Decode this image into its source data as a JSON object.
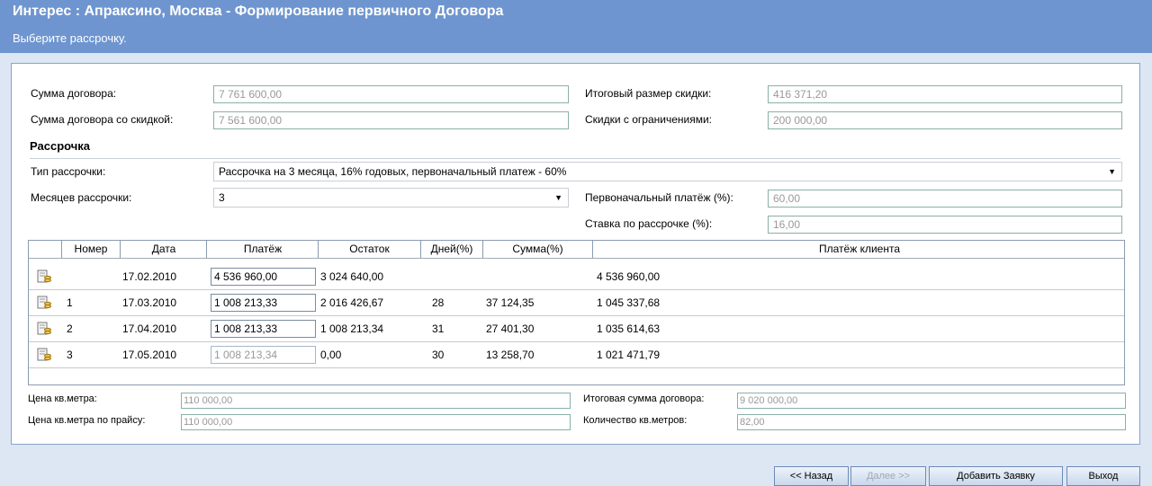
{
  "header": {
    "title": "Интерес : Апраксино, Москва - Формирование первичного Договора",
    "subtitle": "Выберите рассрочку."
  },
  "form": {
    "contract_sum_label": "Сумма договора:",
    "contract_sum_value": "7 761 600,00",
    "contract_sum_discount_label": "Сумма договора со скидкой:",
    "contract_sum_discount_value": "7 561 600,00",
    "total_discount_label": "Итоговый размер скидки:",
    "total_discount_value": "416 371,20",
    "limited_discounts_label": "Скидки с ограничениями:",
    "limited_discounts_value": "200 000,00"
  },
  "installment": {
    "section_title": "Рассрочка",
    "type_label": "Тип рассрочки:",
    "type_value": "Рассрочка на 3 месяца, 16% годовых, первоначальный платеж - 60%",
    "months_label": "Месяцев рассрочки:",
    "months_value": "3",
    "initial_payment_label": "Первоначальный платёж (%):",
    "initial_payment_value": "60,00",
    "rate_label": "Ставка по рассрочке (%):",
    "rate_value": "16,00"
  },
  "grid": {
    "columns": [
      "Номер",
      "Дата",
      "Платёж",
      "Остаток",
      "Дней(%)",
      "Сумма(%)",
      "Платёж клиента"
    ],
    "rows": [
      {
        "number": "",
        "date": "17.02.2010",
        "payment": "4 536 960,00",
        "rest": "3 024 640,00",
        "days": "",
        "sum": "",
        "client": "4 536 960,00"
      },
      {
        "number": "1",
        "date": "17.03.2010",
        "payment": "1 008 213,33",
        "rest": "2 016 426,67",
        "days": "28",
        "sum": "37 124,35",
        "client": "1 045 337,68"
      },
      {
        "number": "2",
        "date": "17.04.2010",
        "payment": "1 008 213,33",
        "rest": "1 008 213,34",
        "days": "31",
        "sum": "27 401,30",
        "client": "1 035 614,63"
      },
      {
        "number": "3",
        "date": "17.05.2010",
        "payment": "1 008 213,34",
        "rest": "0,00",
        "days": "30",
        "sum": "13 258,70",
        "client": "1 021 471,79"
      }
    ]
  },
  "footer": {
    "price_sqm_label": "Цена кв.метра:",
    "price_sqm_value": "110 000,00",
    "price_sqm_list_label": "Цена кв.метра по прайсу:",
    "price_sqm_list_value": "110 000,00",
    "total_contract_label": "Итоговая сумма договора:",
    "total_contract_value": "9 020 000,00",
    "sqm_count_label": "Количество кв.метров:",
    "sqm_count_value": "82,00"
  },
  "buttons": {
    "back": "<< Назад",
    "next": "Далее >>",
    "add": "Добавить Заявку",
    "exit": "Выход"
  }
}
